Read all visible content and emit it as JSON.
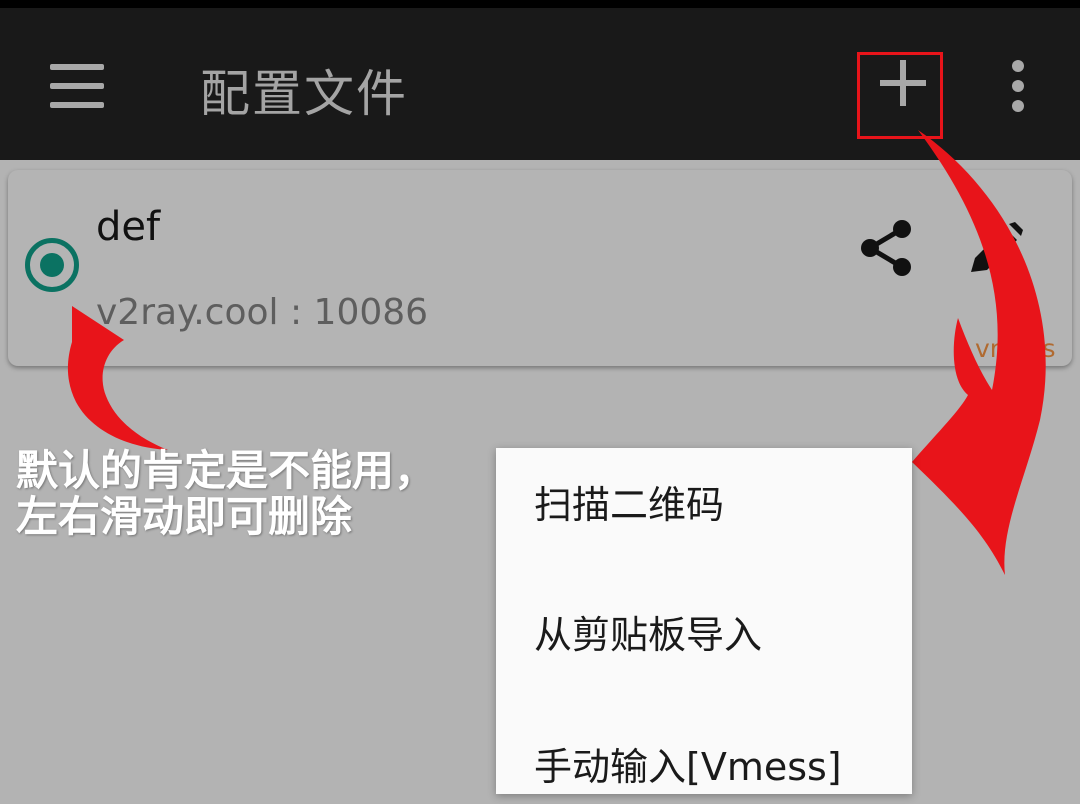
{
  "toolbar": {
    "title": "配置文件",
    "icons": {
      "menu": "hamburger-menu-icon",
      "add": "plus-icon",
      "overflow": "more-vert-icon"
    }
  },
  "profile": {
    "name": "def",
    "address": "v2ray.cool : 10086",
    "type": "vmess",
    "selected": true,
    "icons": {
      "share": "share-icon",
      "edit": "pencil-icon"
    }
  },
  "annotation": {
    "line1": "默认的肯定是不能用，",
    "line2": "左右滑动即可删除"
  },
  "popup_menu": {
    "items": [
      "扫描二维码",
      "从剪贴板导入",
      "手动输入[Vmess]"
    ]
  },
  "colors": {
    "toolbar_bg": "#191919",
    "screen_dim": "#b3b3b3",
    "accent_radio": "#0b7262",
    "type_label": "#b06a30",
    "annotation_red": "#e8141a"
  }
}
